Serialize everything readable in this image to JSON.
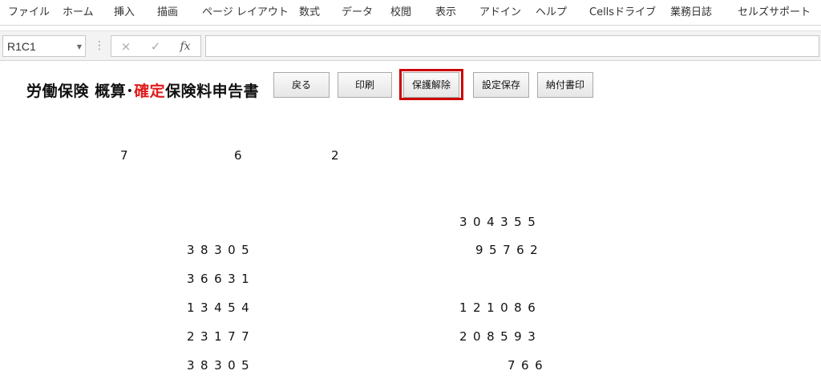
{
  "ribbon": {
    "tabs": [
      "ファイル",
      "ホーム",
      "挿入",
      "描画",
      "ページ レイアウト",
      "数式",
      "データ",
      "校閲",
      "表示",
      "アドイン",
      "ヘルプ",
      "Cellsドライブ",
      "業務日誌",
      "セルズサポート"
    ]
  },
  "formula_bar": {
    "name_box": "R1C1",
    "cancel_icon": "×",
    "enter_icon": "✓",
    "fx_label": "fx",
    "formula": ""
  },
  "sheet": {
    "title_part1": "労働保険 概算･",
    "title_red": "確定",
    "title_part2": "保険料申告書",
    "buttons": {
      "back": "戻る",
      "print": "印刷",
      "unprotect": "保護解除",
      "save_settings": "設定保存",
      "payment_print": "納付書印"
    },
    "date": {
      "a": "7",
      "b": "6",
      "c": "2"
    },
    "left_values": [
      "38305",
      "36631",
      "13454",
      "23177",
      "38305"
    ],
    "right_values": [
      "304355",
      "95762",
      "121086",
      "208593",
      "766"
    ],
    "highlight_color": "#cc0000"
  }
}
